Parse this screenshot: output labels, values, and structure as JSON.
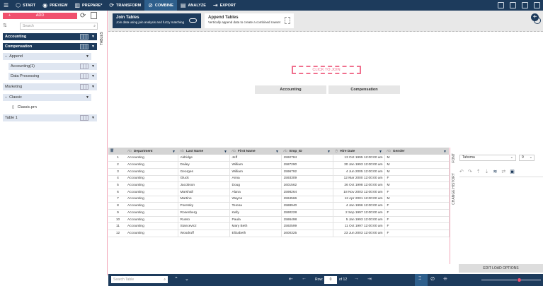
{
  "topbar": {
    "menu_icon": "hamburger-icon",
    "items": [
      {
        "label": "START",
        "icon": "cube-icon"
      },
      {
        "label": "PREVIEW",
        "icon": "eye-icon"
      },
      {
        "label": "PREPARE*",
        "icon": "columns-icon"
      },
      {
        "label": "TRANSFORM",
        "icon": "cycle-icon"
      },
      {
        "label": "COMBINE",
        "icon": "combine-icon",
        "active": true
      },
      {
        "label": "ANALYZE",
        "icon": "clipboard-icon"
      },
      {
        "label": "EXPORT",
        "icon": "export-icon"
      }
    ]
  },
  "sidebar": {
    "add_label": "ADD",
    "search_placeholder": "Search",
    "tables_label": "TABLES",
    "items": [
      {
        "label": "Accounting"
      },
      {
        "label": "Compensation"
      },
      {
        "label": "Append"
      },
      {
        "label": "Accounting(1)"
      },
      {
        "label": "Data Processing"
      },
      {
        "label": "Marketing"
      },
      {
        "label": "Classic"
      },
      {
        "label": "Classic.prn"
      },
      {
        "label": "Table 1"
      }
    ]
  },
  "combine": {
    "join_title": "Join Tables",
    "join_desc": "Join data using join analysis and fuzzy matching",
    "append_title": "Append Tables",
    "append_desc": "Vertically append data to create a combined rowset",
    "click_to_join": "CLICK TO JOIN",
    "left_table": "Accounting",
    "right_table": "Compensation",
    "accent": "#f0708e",
    "arrow_color": "#ff0000"
  },
  "grid": {
    "columns": [
      {
        "type": "Ab",
        "label": "Department"
      },
      {
        "type": "Ab",
        "label": "Last Name"
      },
      {
        "type": "Ab",
        "label": "First Name"
      },
      {
        "type": "Ab",
        "label": "Emp_ID"
      },
      {
        "type": "clock",
        "label": "Hire Date"
      },
      {
        "type": "Ab",
        "label": "Gender"
      }
    ],
    "rows": [
      [
        "1",
        "Accounting",
        "Aldridge",
        "Jeff",
        "1592784",
        "13 Oct 1995 12:00:00 am",
        "M"
      ],
      [
        "2",
        "Accounting",
        "Dailey",
        "William",
        "1587290",
        "30 Jan 1993 12:00:00 am",
        "M"
      ],
      [
        "3",
        "Accounting",
        "Georges",
        "William",
        "1596792",
        "4 Jun 2005 12:00:00 am",
        "M"
      ],
      [
        "4",
        "Accounting",
        "Gluck",
        "Anna",
        "1593309",
        "12 Mar 2000 12:00:00 am",
        "F"
      ],
      [
        "5",
        "Accounting",
        "Jacobson",
        "Doug",
        "1601562",
        "26 Oct 1998 12:00:00 am",
        "M"
      ],
      [
        "6",
        "Accounting",
        "Marshall",
        "Alana",
        "1598264",
        "18 Nov 2003 12:00:00 am",
        "F"
      ],
      [
        "7",
        "Accounting",
        "Martino",
        "Wayne",
        "1594566",
        "12 Apr 2001 12:00:00 am",
        "M"
      ],
      [
        "8",
        "Accounting",
        "Poretsky",
        "Teresa",
        "1588940",
        "4 Jan 1996 12:00:00 am",
        "F"
      ],
      [
        "9",
        "Accounting",
        "Rosenberg",
        "Kelly",
        "1590228",
        "2 Sep 1997 12:00:00 am",
        "F"
      ],
      [
        "10",
        "Accounting",
        "Russo",
        "Paula",
        "1586498",
        "5 Jan 1993 12:00:00 am",
        "F"
      ],
      [
        "11",
        "Accounting",
        "Stancevicz",
        "Mary Beth",
        "1592599",
        "11 Oct 1997 12:00:00 am",
        "F"
      ],
      [
        "12",
        "Accounting",
        "Woodruff",
        "Elizabeth",
        "1600325",
        "23 Jun 2003 12:00:00 am",
        "F"
      ]
    ]
  },
  "right_panel": {
    "font_label": "FONT",
    "history_label": "CHANGE HISTORY",
    "font_value": "Tahoma",
    "size_value": "9",
    "edit_load_options": "EDIT LOAD OPTIONS"
  },
  "bottom": {
    "search_placeholder": "Search Table",
    "row_label": "Row:",
    "row_value": "0",
    "of_label": "of 12"
  }
}
